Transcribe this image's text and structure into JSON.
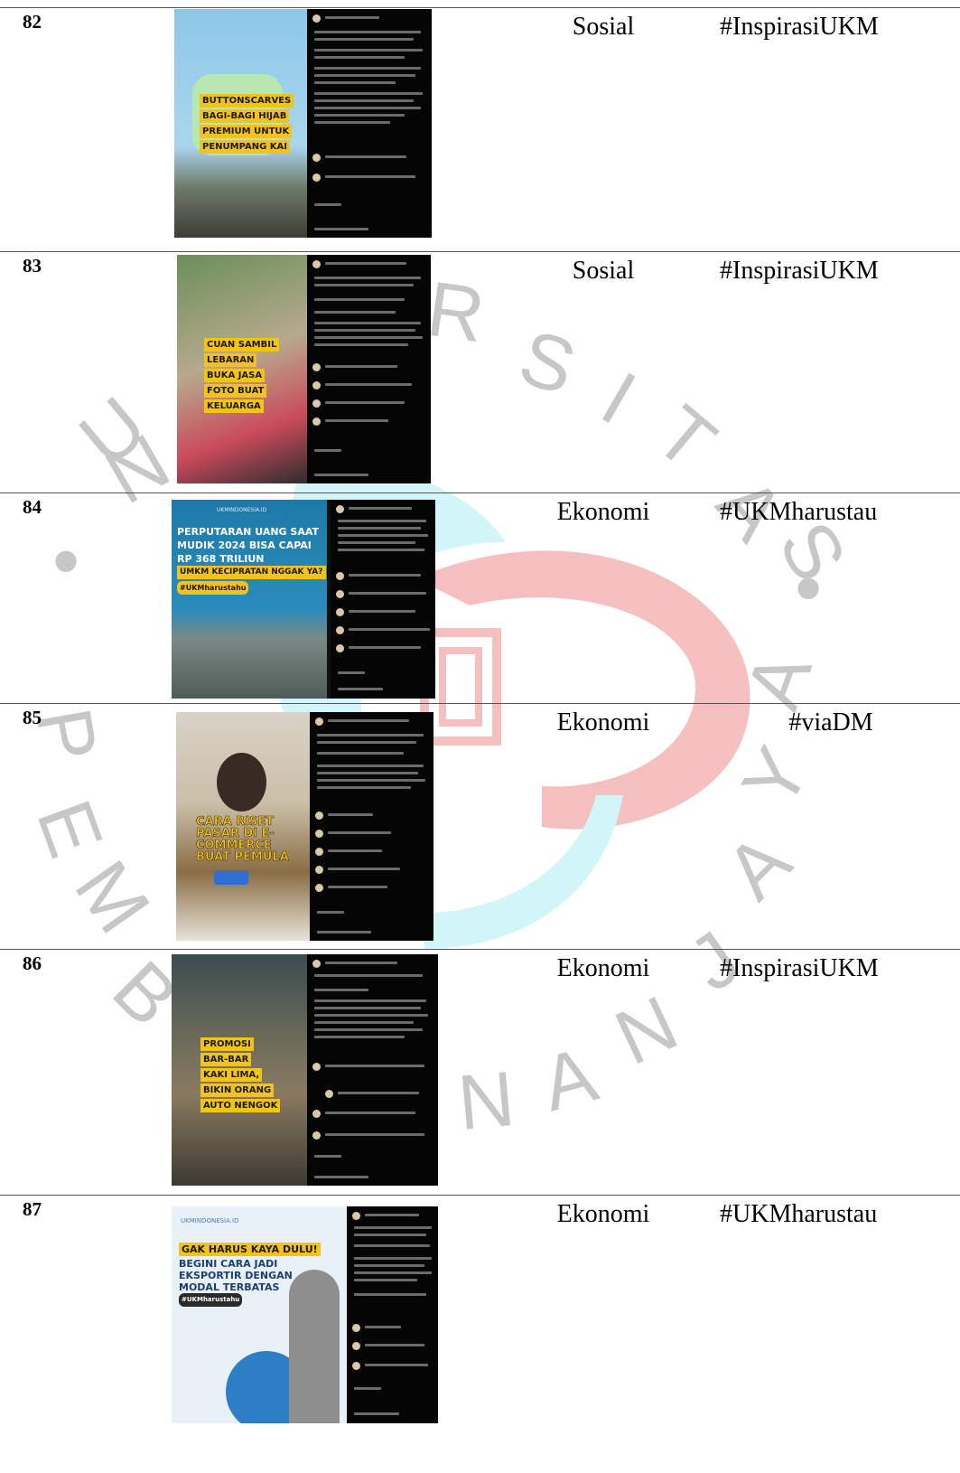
{
  "rows": [
    {
      "number": "82",
      "category": "Sosial",
      "hashtag": "#InspirasiUKM",
      "thumbnail_caption": [
        "BUTTONSCARVES",
        "BAGI-BAGI HIJAB",
        "PREMIUM UNTUK",
        "PENUMPANG KAI"
      ]
    },
    {
      "number": "83",
      "category": "Sosial",
      "hashtag": "#InspirasiUKM",
      "thumbnail_caption": [
        "CUAN SAMBIL",
        "LEBARAN",
        "BUKA JASA",
        "FOTO BUAT",
        "KELUARGA"
      ]
    },
    {
      "number": "84",
      "category": "Ekonomi",
      "hashtag": "#UKMharustau",
      "thumbnail_caption": [
        "PERPUTARAN UANG SAAT",
        "MUDIK 2024 BISA CAPAI",
        "RP 368 TRILIUN",
        "UMKM KECIPRATAN NGGAK YA?",
        "#UKMharustahu"
      ]
    },
    {
      "number": "85",
      "category": "Ekonomi",
      "hashtag": "#viaDM",
      "thumbnail_caption": [
        "CARA RISET",
        "PASAR DI E-",
        "COMMERCE",
        "BUAT PEMULA"
      ]
    },
    {
      "number": "86",
      "category": "Ekonomi",
      "hashtag": "#InspirasiUKM",
      "thumbnail_caption": [
        "PROMOSI",
        "BAR-BAR",
        "KAKI LIMA,",
        "BIKIN ORANG",
        "AUTO NENGOK"
      ]
    },
    {
      "number": "87",
      "category": "Ekonomi",
      "hashtag": "#UKMharustau",
      "thumbnail_caption": [
        "GAK HARUS KAYA DULU!",
        "BEGINI CARA JADI",
        "EKSPORTIR DENGAN",
        "MODAL TERBATAS",
        "#UKMharustahu"
      ],
      "brand": "UKMINDONESIA.ID"
    }
  ],
  "watermark": {
    "letters": [
      "U",
      "N",
      "I",
      "V",
      "E",
      "R",
      "S",
      "I",
      "T",
      "A",
      "S",
      "P",
      "E",
      "M",
      "B",
      "A",
      "N",
      "G",
      "U",
      "N",
      "A",
      "N",
      "J",
      "A",
      "Y",
      "A"
    ],
    "colors": {
      "letters": "#9a9a9a",
      "logo_red": "#e64a4a",
      "logo_cyan": "#3fd0e6"
    }
  },
  "icons": [
    "instagram-post-screenshot"
  ]
}
